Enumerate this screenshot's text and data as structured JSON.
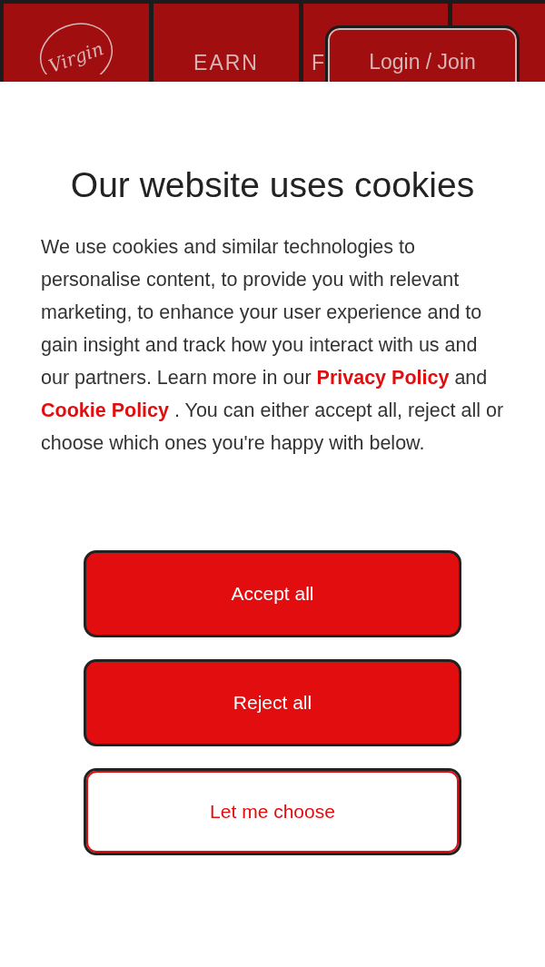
{
  "header": {
    "logo": {
      "text": "Virgin"
    },
    "tabs": [
      {
        "label": "EARN"
      },
      {
        "label": "F"
      }
    ],
    "login_button": "Login / Join"
  },
  "cookie_dialog": {
    "title": "Our website uses cookies",
    "paragraph_start": "We use cookies and similar technologies to personalise content, to provide you with relevant marketing, to enhance your user experience and to gain insight and track how you interact with us and our partners. Learn more in our",
    "privacy_link": "Privacy Policy",
    "joiner": "and",
    "cookie_link": "Cookie Policy",
    "paragraph_end": ". You can either accept all, reject all or choose which ones you're happy with below.",
    "buttons": [
      {
        "label": "Accept all",
        "kind": "filled"
      },
      {
        "label": "Reject all",
        "kind": "filled"
      },
      {
        "label": "Let me choose",
        "kind": "outline"
      }
    ]
  }
}
